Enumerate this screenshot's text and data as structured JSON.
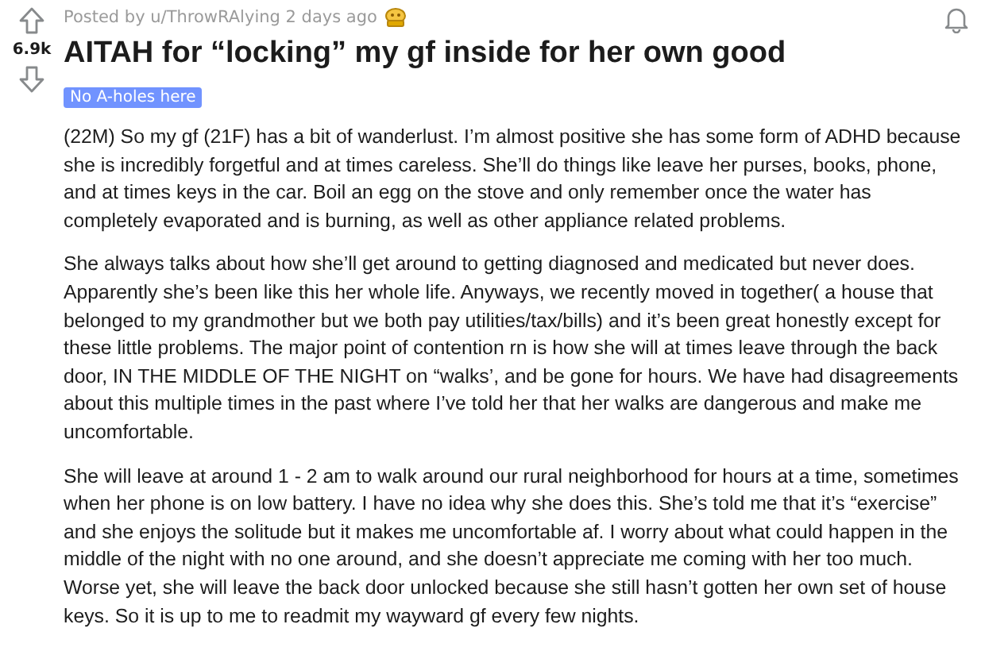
{
  "post": {
    "posted_by": "Posted by u/ThrowRAlying 2 days ago",
    "vote_count": "6.9k",
    "title": "AITAH for “locking” my gf inside for her own good",
    "flair": "No A-holes here",
    "paragraphs": [
      "(22M) So my gf (21F) has a bit of wanderlust. I’m almost positive she has some form of ADHD because she is incredibly forgetful and at times careless. She’ll do things like leave her purses, books, phone, and at times keys in the car. Boil an egg on the stove and only remember once the water has completely evaporated and is burning, as well as other appliance related problems.",
      "She always talks about how she’ll get around to getting diagnosed and medicated but never does. Apparently she’s been like this her whole life. Anyways, we recently moved in together( a house that belonged to my grandmother but we both pay utilities/tax/bills) and it’s been great honestly except for these little problems. The major point of contention rn is how she will at times leave through the back door, IN THE MIDDLE OF THE NIGHT on “walks’, and be gone for hours. We have had disagreements about this multiple times in the past where I’ve told her that her walks are dangerous and make me uncomfortable.",
      "She will leave at around 1 - 2 am to walk around our rural neighborhood for hours at a time, sometimes when her phone is on low battery. I have no idea why she does this. She’s told me that it’s “exercise” and she enjoys the solitude but it makes me uncomfortable af. I worry about what could happen in the middle of the night with no one around, and she doesn’t appreciate me coming with her too much. Worse yet, she will leave the back door unlocked because she still hasn’t gotten her own set of house keys. So it is up to me to readmit my wayward gf every few nights."
    ]
  }
}
